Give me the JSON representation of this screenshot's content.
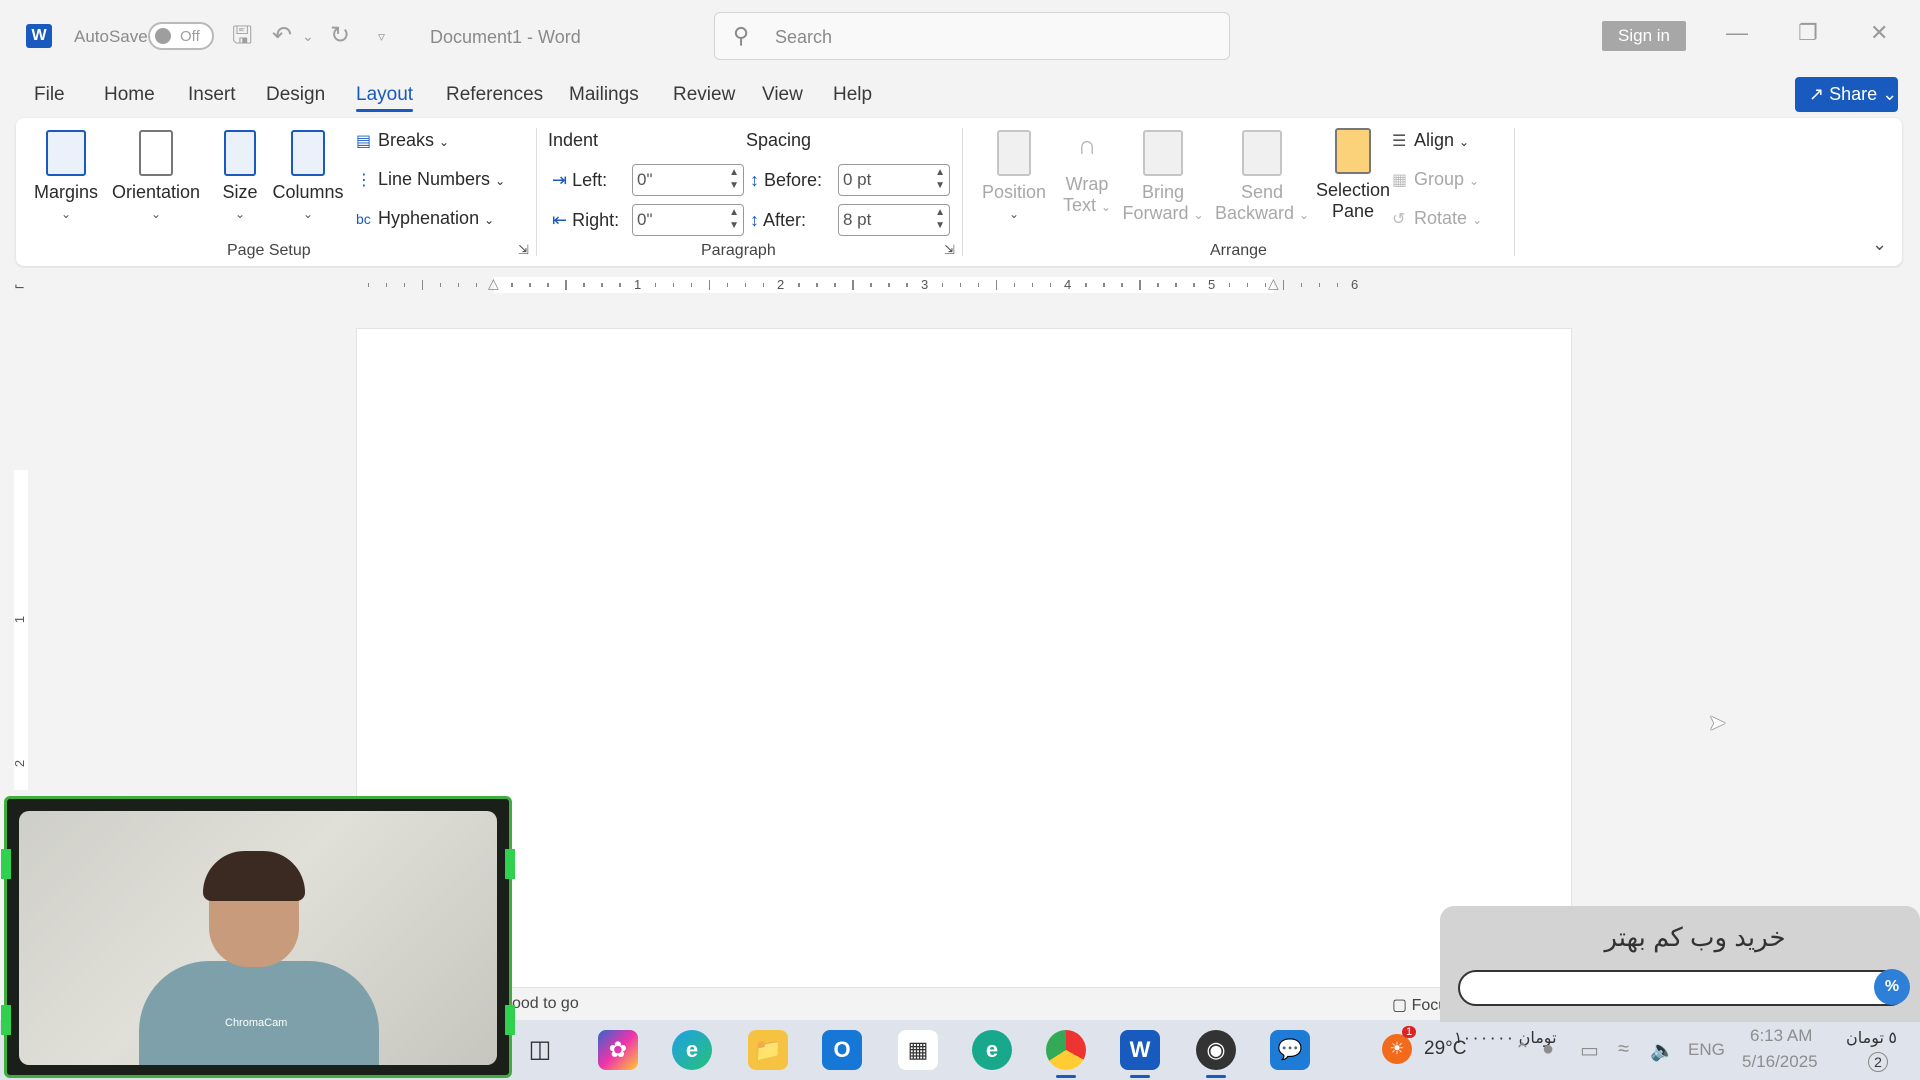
{
  "titlebar": {
    "autosave_label": "AutoSave",
    "autosave_state": "Off",
    "document_name": "Document1  -  Word",
    "search_placeholder": "Search",
    "sign_in": "Sign in"
  },
  "tabs": [
    "File",
    "Home",
    "Insert",
    "Design",
    "Layout",
    "References",
    "Mailings",
    "Review",
    "View",
    "Help"
  ],
  "active_tab": "Layout",
  "share_label": "Share",
  "ribbon": {
    "page_setup": {
      "group_label": "Page Setup",
      "margins": "Margins",
      "orientation": "Orientation",
      "size": "Size",
      "columns": "Columns",
      "breaks": "Breaks",
      "line_numbers": "Line Numbers",
      "hyphenation": "Hyphenation"
    },
    "paragraph": {
      "group_label": "Paragraph",
      "indent_label": "Indent",
      "spacing_label": "Spacing",
      "left_label": "Left:",
      "left_value": "0\"",
      "right_label": "Right:",
      "right_value": "0\"",
      "before_label": "Before:",
      "before_value": "0 pt",
      "after_label": "After:",
      "after_value": "8 pt"
    },
    "arrange": {
      "group_label": "Arrange",
      "position": "Position",
      "wrap_text_1": "Wrap",
      "wrap_text_2": "Text",
      "bring_forward_1": "Bring",
      "bring_forward_2": "Forward",
      "send_backward_1": "Send",
      "send_backward_2": "Backward",
      "selection_pane_1": "Selection",
      "selection_pane_2": "Pane",
      "align": "Align",
      "group": "Group",
      "rotate": "Rotate"
    }
  },
  "ruler_numbers": [
    "1",
    "2",
    "3",
    "4",
    "5",
    "6"
  ],
  "vertical_ruler_numbers": [
    "1",
    "2"
  ],
  "status": {
    "accessibility": "ood to go",
    "focus": "Focus"
  },
  "taskbar": {
    "weather_temp": "29°C",
    "weather_badge": "1",
    "price_text": "۱۰۰۰۰۰۰ تومان",
    "language": "ENG",
    "time": "6:13 AM",
    "date": "5/16/2025",
    "corner_text": "٥ تومان",
    "notification_count": "2"
  },
  "webcam": {
    "label": "ChromaCam"
  },
  "promo": {
    "title": "خرید وب کم بهتر",
    "percent_symbol": "%"
  }
}
